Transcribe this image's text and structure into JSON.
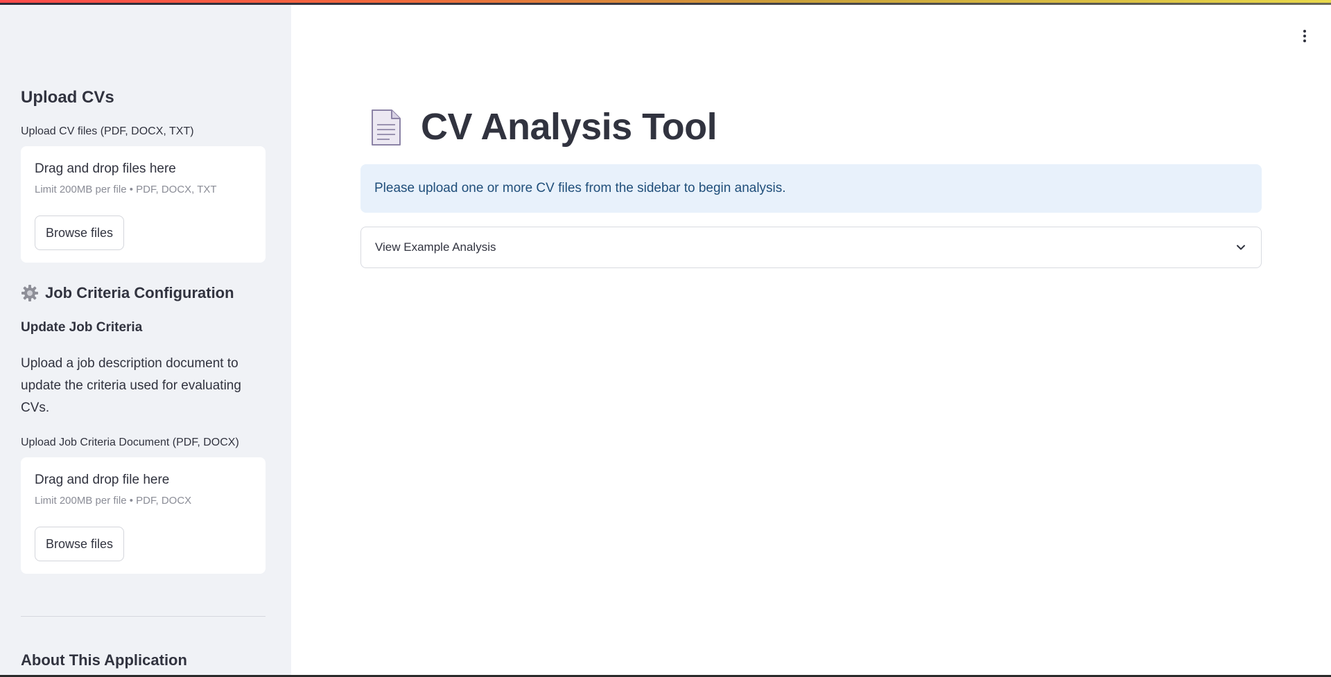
{
  "sidebar": {
    "upload_cvs_heading": "Upload CVs",
    "cv_uploader": {
      "label": "Upload CV files (PDF, DOCX, TXT)",
      "drop_text": "Drag and drop files here",
      "limit_text": "Limit 200MB per file • PDF, DOCX, TXT",
      "button_label": "Browse files"
    },
    "job_config_heading": "Job Criteria Configuration",
    "update_criteria_heading": "Update Job Criteria",
    "update_criteria_text": "Upload a job description document to update the criteria used for evaluating CVs.",
    "job_uploader": {
      "label": "Upload Job Criteria Document (PDF, DOCX)",
      "drop_text": "Drag and drop file here",
      "limit_text": "Limit 200MB per file • PDF, DOCX",
      "button_label": "Browse files"
    },
    "about_heading": "About This Application"
  },
  "main": {
    "title": "CV Analysis Tool",
    "info_message": "Please upload one or more CV files from the sidebar to begin analysis.",
    "expander_label": "View Example Analysis"
  },
  "icons": {
    "title_icon": "page-facing-up-icon",
    "config_icon": "gear-icon",
    "menu_icon": "kebab-menu-icon",
    "expander_icon": "chevron-down-icon"
  },
  "colors": {
    "sidebar_bg": "#f0f2f6",
    "info_bg": "#e8f1fb",
    "info_text": "#1f4e7a",
    "text": "#31333f"
  }
}
